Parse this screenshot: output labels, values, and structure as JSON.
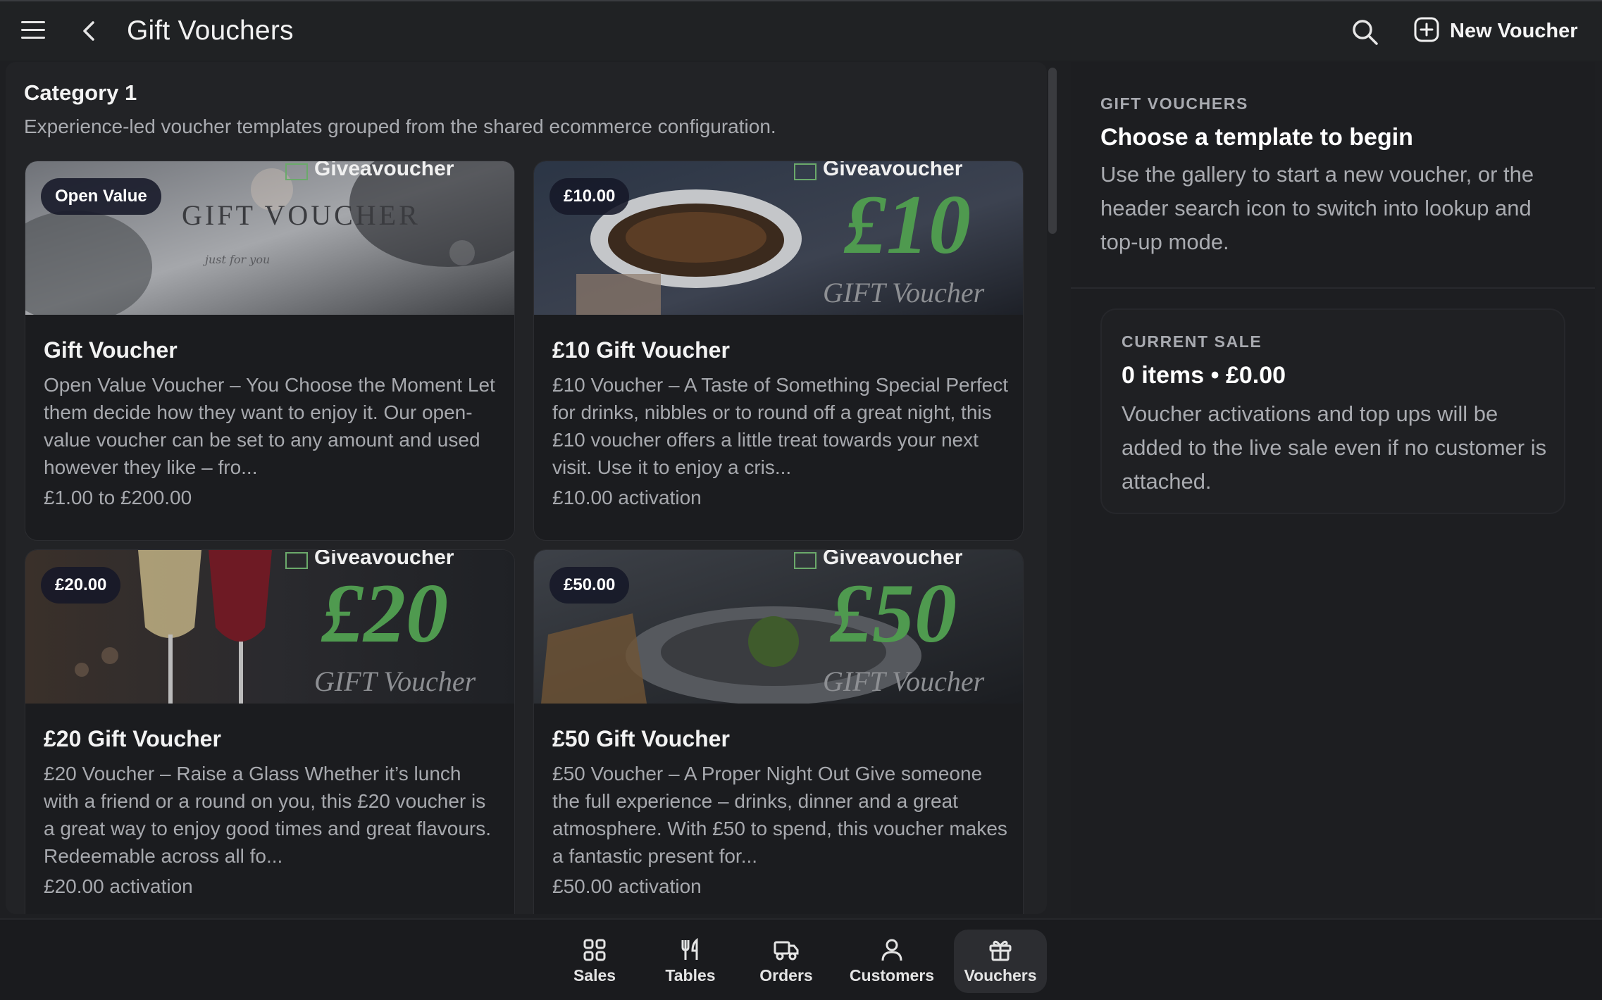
{
  "header": {
    "title": "Gift Vouchers",
    "new_voucher_label": "New Voucher",
    "icons": [
      "menu-icon",
      "back-chevron-icon",
      "search-icon",
      "plus-square-icon"
    ]
  },
  "category": {
    "title": "Category 1",
    "description": "Experience-led voucher templates grouped from the shared ecommerce configuration."
  },
  "brand_text": "Giveavoucher",
  "cards": [
    {
      "badge": "Open Value",
      "name": "Gift Voucher",
      "description": "Open Value Voucher – You Choose the Moment Let them decide how they want to enjoy it. Our open-value voucher can be set to any amount and used however they like – fro...",
      "price": "£1.00 to £200.00",
      "image_text": "GIFT VOUCHER",
      "image_script": "just for you"
    },
    {
      "badge": "£10.00",
      "name": "£10 Gift Voucher",
      "description": "£10 Voucher – A Taste of Something Special Perfect for drinks, nibbles or to round off a great night, this £10 voucher offers a little treat towards your next visit. Use it to enjoy a cris...",
      "price": "£10.00 activation",
      "image_big": "£10",
      "image_caption": "GIFT Voucher"
    },
    {
      "badge": "£20.00",
      "name": "£20 Gift Voucher",
      "description": "£20 Voucher – Raise a Glass Whether it’s lunch with a friend or a round on you, this £20 voucher is a great way to enjoy good times and great flavours. Redeemable across all fo...",
      "price": "£20.00 activation",
      "image_big": "£20",
      "image_caption": "GIFT Voucher"
    },
    {
      "badge": "£50.00",
      "name": "£50 Gift Voucher",
      "description": "£50 Voucher – A Proper Night Out Give someone the full experience – drinks, dinner and a great atmosphere. With £50 to spend, this voucher makes a fantastic present for...",
      "price": "£50.00 activation",
      "image_big": "£50",
      "image_caption": "GIFT Voucher"
    }
  ],
  "side": {
    "eyebrow": "GIFT VOUCHERS",
    "heading": "Choose a template to begin",
    "body": "Use the gallery to start a new voucher, or the header search icon to switch into lookup and top-up mode."
  },
  "sale": {
    "eyebrow": "CURRENT SALE",
    "amount": "0 items • £0.00",
    "body": "Voucher activations and top ups will be added to the live sale even if no customer is attached."
  },
  "nav": [
    {
      "label": "Sales",
      "icon": "grid-icon",
      "active": false
    },
    {
      "label": "Tables",
      "icon": "cutlery-icon",
      "active": false
    },
    {
      "label": "Orders",
      "icon": "truck-icon",
      "active": false
    },
    {
      "label": "Customers",
      "icon": "person-icon",
      "active": false
    },
    {
      "label": "Vouchers",
      "icon": "gift-icon",
      "active": true
    }
  ],
  "colors": {
    "background": "#1e1f22",
    "card": "#1b1c1f",
    "accent_green": "#4f9a4f",
    "badge_bg": "#161828",
    "muted_text": "#a9abb0"
  }
}
